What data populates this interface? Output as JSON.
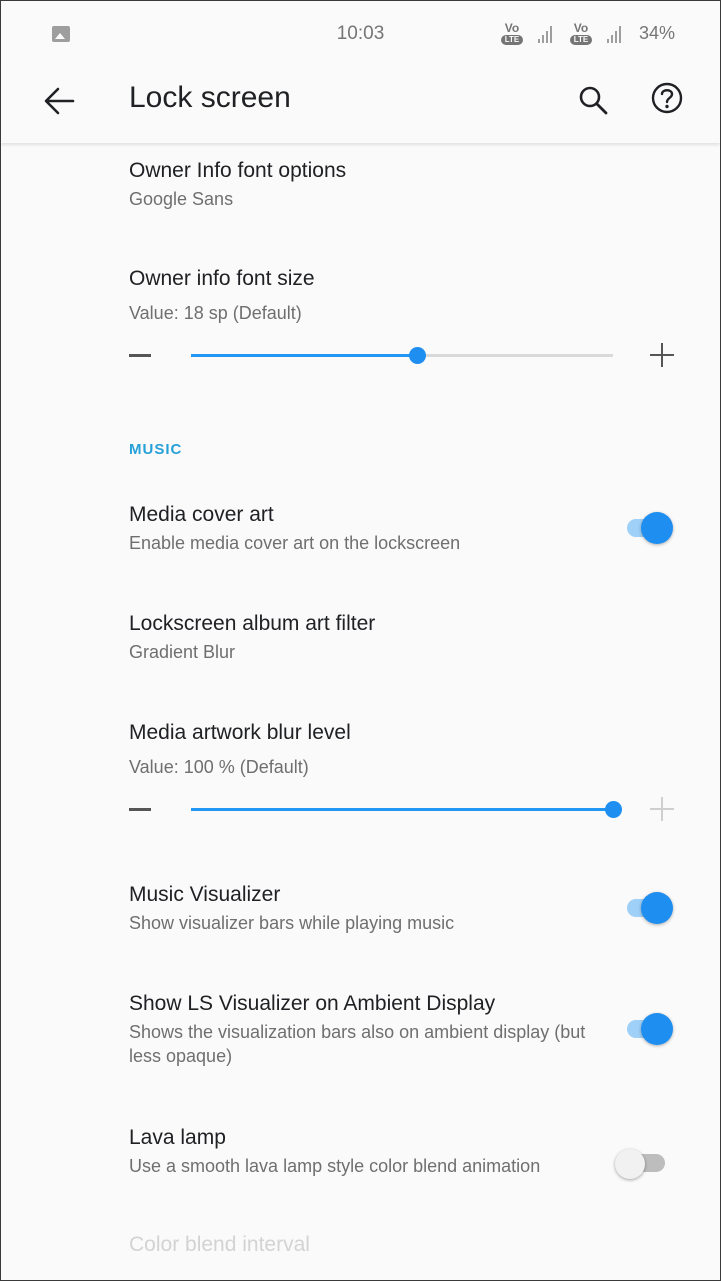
{
  "status_bar": {
    "time": "10:03",
    "battery": "34%",
    "volte_label": "Vo",
    "lte_label": "LTE",
    "icons": [
      "image-notification-icon",
      "volte-icon",
      "signal-icon",
      "volte-icon",
      "signal-icon"
    ]
  },
  "toolbar": {
    "title": "Lock screen",
    "back_icon": "arrow-back-icon",
    "search_icon": "search-icon",
    "help_icon": "help-icon"
  },
  "settings": {
    "owner_font": {
      "title": "Owner Info font options",
      "summary": "Google Sans"
    },
    "owner_size": {
      "title": "Owner info font size",
      "summary": "Value: 18 sp (Default)",
      "slider_fraction": 0.535
    },
    "music_category": "MUSIC",
    "media_cover": {
      "title": "Media cover art",
      "summary": "Enable media cover art on the lockscreen",
      "enabled": true
    },
    "album_filter": {
      "title": "Lockscreen album art filter",
      "summary": "Gradient Blur"
    },
    "blur_level": {
      "title": "Media artwork blur level",
      "summary": "Value: 100 % (Default)",
      "slider_fraction": 1.0
    },
    "visualizer": {
      "title": "Music Visualizer",
      "summary": "Show visualizer bars while playing music",
      "enabled": true
    },
    "ls_visualizer": {
      "title": "Show LS Visualizer on Ambient Display",
      "summary": "Shows the visualization bars also on ambient display (but less opaque)",
      "enabled": true
    },
    "lava_lamp": {
      "title": "Lava lamp",
      "summary": "Use a smooth lava lamp style color blend animation",
      "enabled": false
    },
    "color_blend": {
      "title": "Color blend interval"
    }
  },
  "colors": {
    "accent": "#1e8ef0",
    "category": "#26a0d8"
  }
}
